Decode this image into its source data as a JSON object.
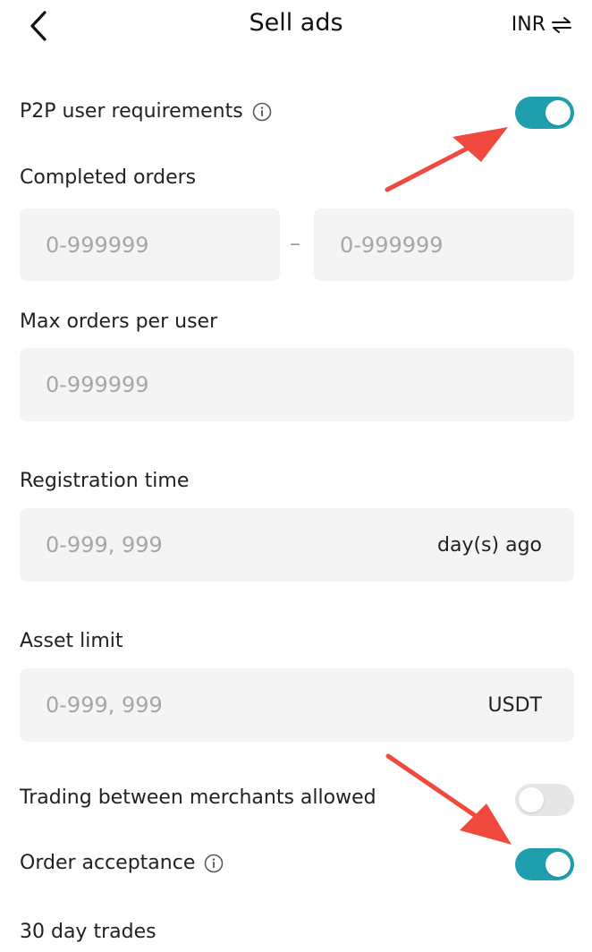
{
  "header": {
    "title": "Sell ads",
    "currency": "INR"
  },
  "p2p_requirements": {
    "label": "P2P user requirements",
    "enabled": true
  },
  "completed_orders": {
    "label": "Completed orders",
    "min_placeholder": "0-999999",
    "separator": "–",
    "max_placeholder": "0-999999"
  },
  "max_orders": {
    "label": "Max orders per user",
    "placeholder": "0-999999"
  },
  "registration_time": {
    "label": "Registration time",
    "placeholder": "0-999, 999",
    "unit": "day(s) ago"
  },
  "asset_limit": {
    "label": "Asset limit",
    "placeholder": "0-999, 999",
    "unit": "USDT"
  },
  "merchants_trading": {
    "label": "Trading between merchants allowed",
    "enabled": false
  },
  "order_acceptance": {
    "label": "Order acceptance",
    "enabled": true
  },
  "thirty_day_trades": {
    "label": "30 day trades"
  },
  "colors": {
    "toggle_on": "#1f9fae",
    "toggle_off": "#e6e6e6",
    "annotation_arrow": "#f04a3e",
    "field_bg": "#f4f4f4"
  }
}
